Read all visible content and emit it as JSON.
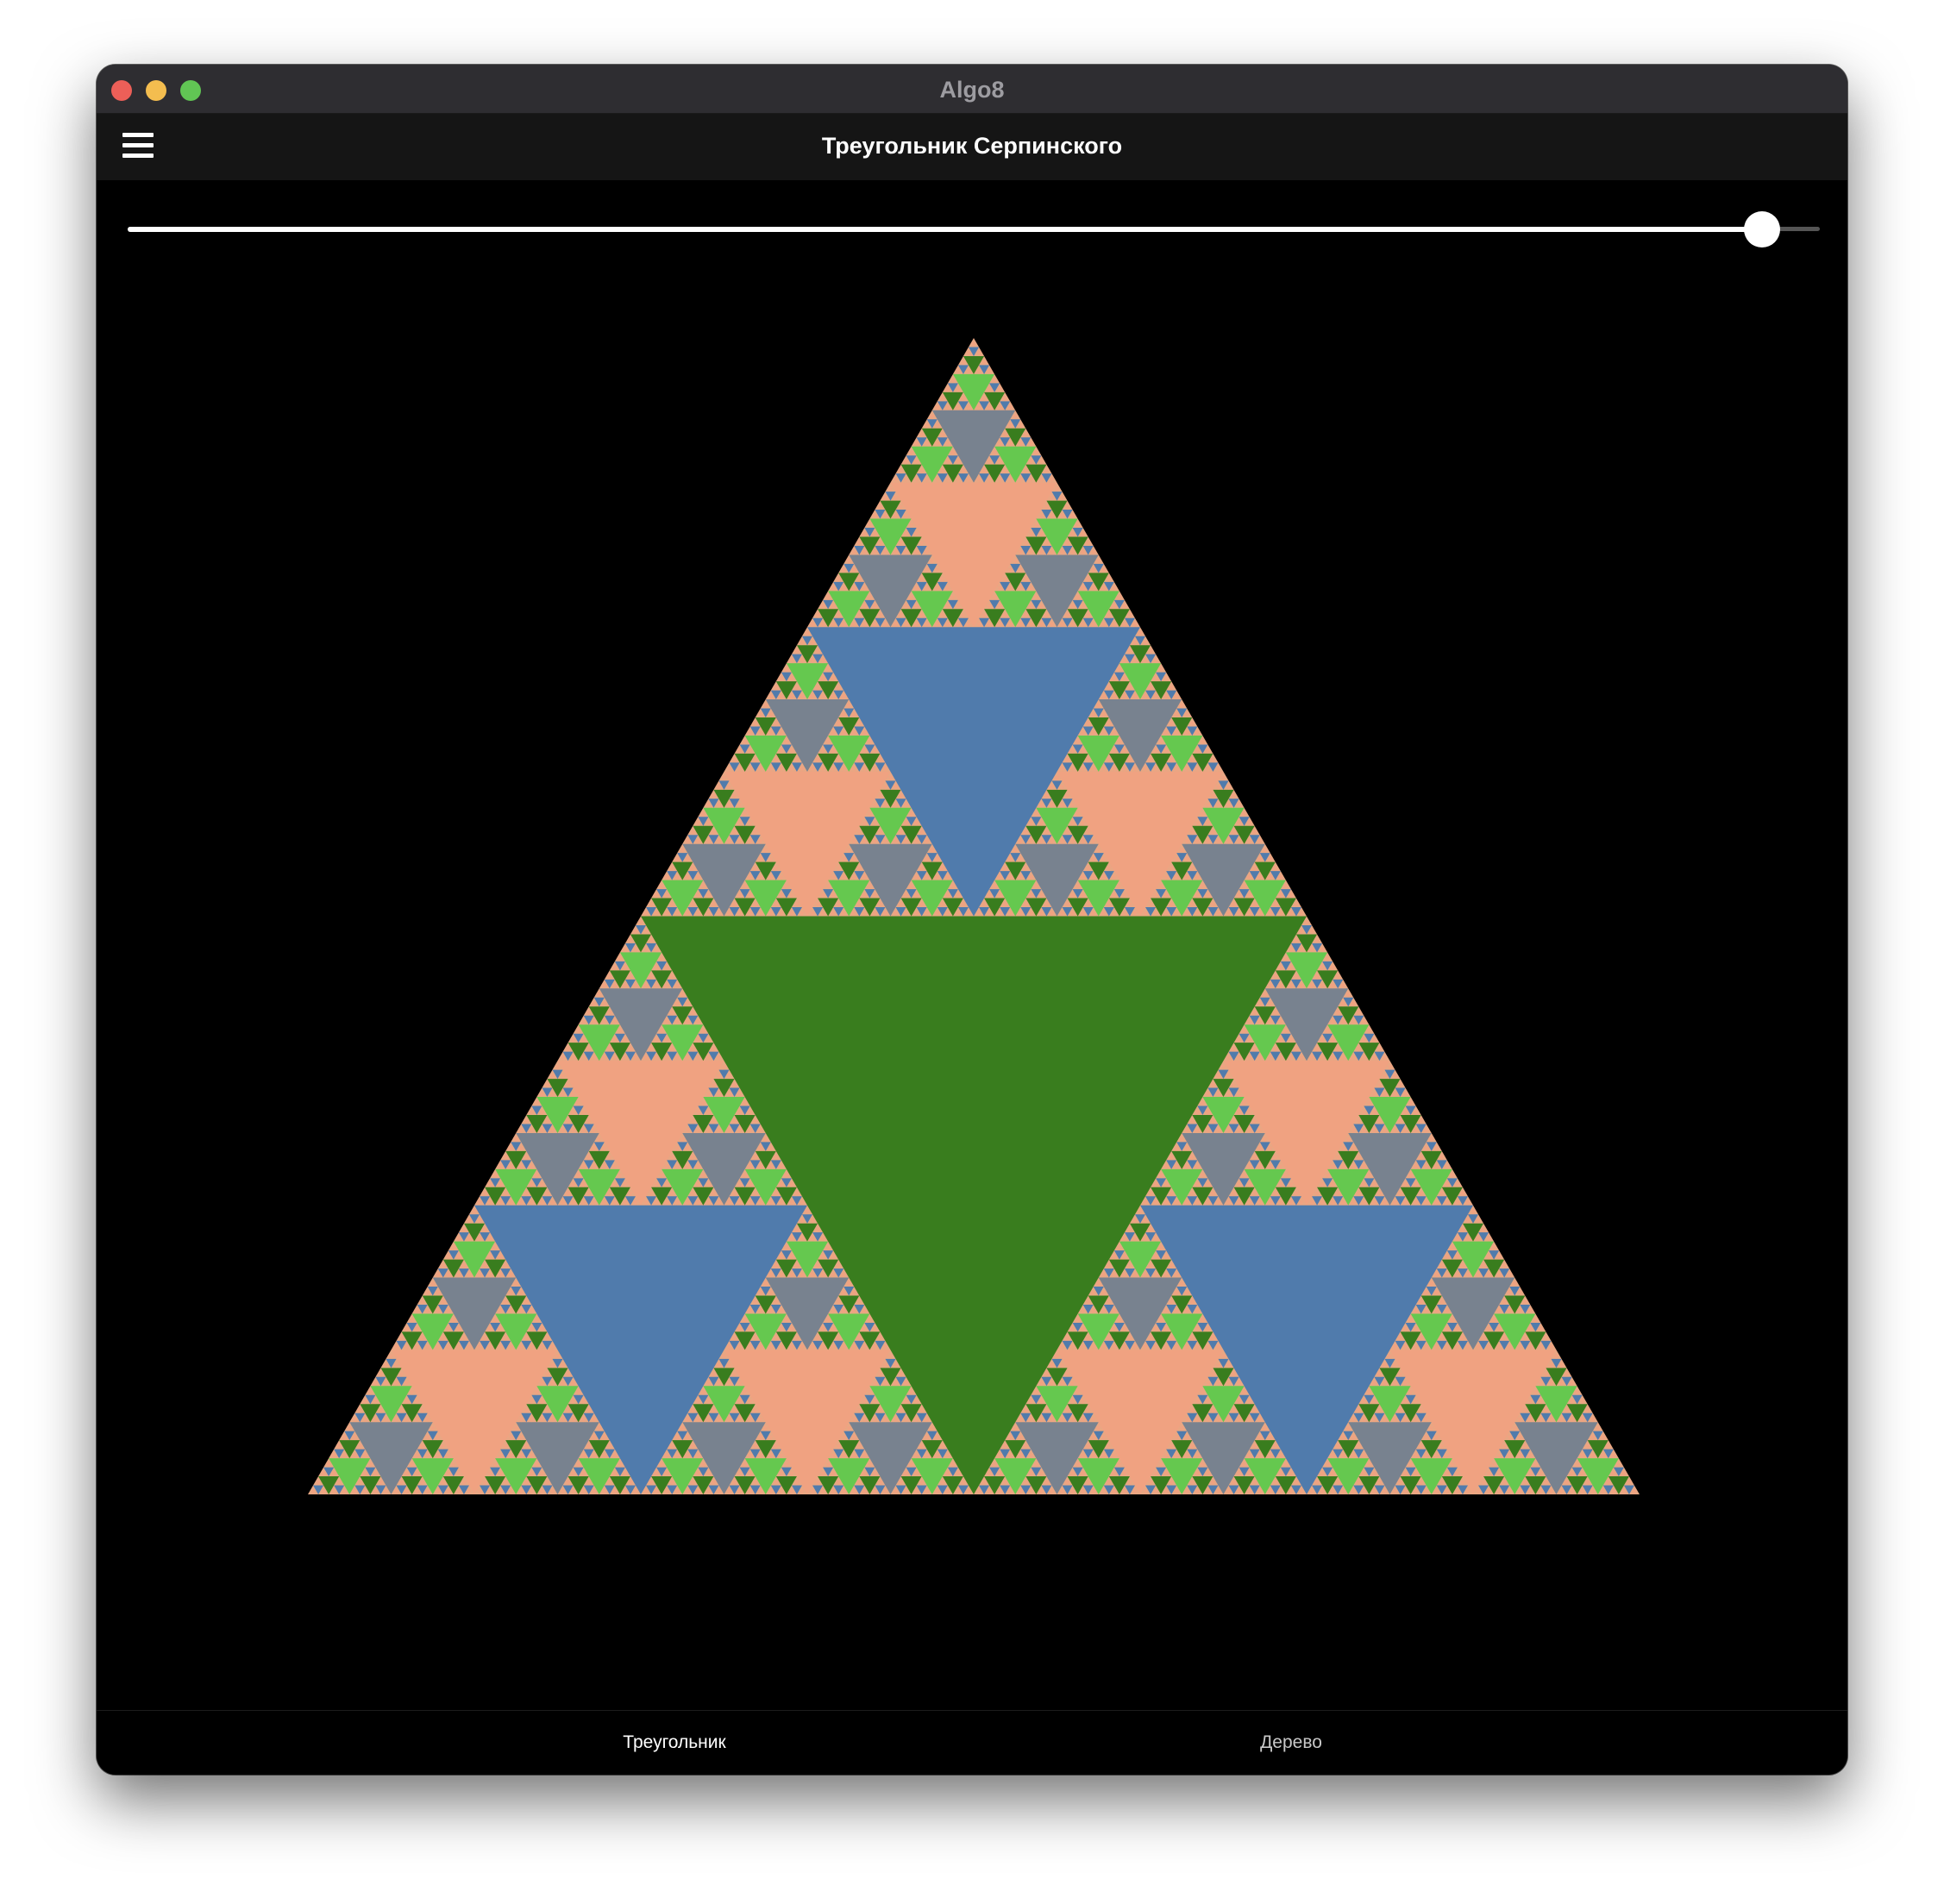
{
  "window": {
    "title": "Algo8"
  },
  "appbar": {
    "menu_icon": "hamburger-menu-icon",
    "title": "Треугольник Серпинского"
  },
  "slider": {
    "value_fraction": 0.966
  },
  "fractal": {
    "depth": 8,
    "colors": {
      "background": "#e8a783",
      "level_1": "#397d1e",
      "level_2": "#507bac",
      "level_3": "#f0a281",
      "level_4": "#78828f",
      "level_5": "#65c84f",
      "level_6": "#397d1e",
      "level_7": "#507bac",
      "level_8": "#f0a281"
    }
  },
  "bottom_nav": {
    "items": [
      {
        "label": "Треугольник",
        "active": true
      },
      {
        "label": "Дерево",
        "active": false
      }
    ]
  }
}
